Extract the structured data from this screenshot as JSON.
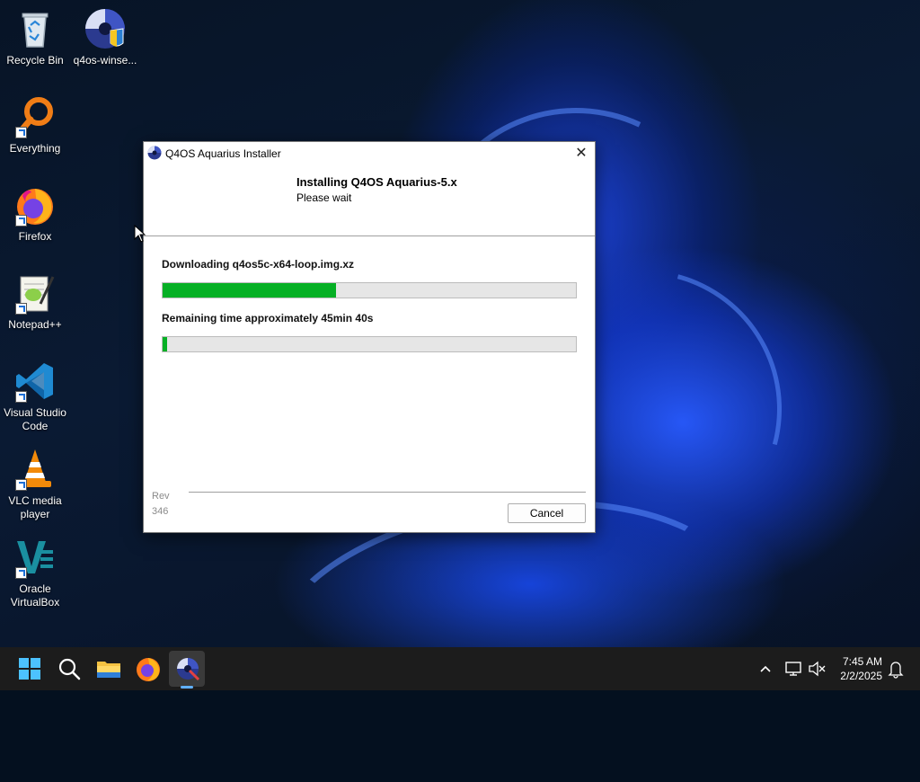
{
  "desktop": {
    "icons": [
      {
        "label": "Recycle Bin"
      },
      {
        "label": "q4os-winse..."
      },
      {
        "label": "Everything"
      },
      {
        "label": "Firefox"
      },
      {
        "label": "Notepad++"
      },
      {
        "label": "Visual Studio Code"
      },
      {
        "label": "VLC media player"
      },
      {
        "label": "Oracle VirtualBox"
      }
    ]
  },
  "dialog": {
    "title": "Q4OS Aquarius Installer",
    "close_label": "✕",
    "heading": "Installing Q4OS Aquarius-5.x",
    "subheading": "Please wait",
    "download_status": "Downloading q4os5c-x64-loop.img.xz",
    "download_progress_percent": 42,
    "remaining_time": "Remaining time approximately 45min 40s",
    "overall_progress_percent": 1,
    "revision": "Rev\n346",
    "cancel_label": "Cancel"
  },
  "taskbar": {
    "items": [
      "start-icon",
      "search-icon",
      "file-explorer-icon",
      "firefox-icon",
      "q4os-installer-icon"
    ],
    "active_item": "q4os-installer-icon",
    "tray_icons": [
      "chevron-up-icon",
      "network-icon",
      "volume-muted-icon",
      "notification-bell-icon"
    ],
    "time": "7:45 AM",
    "date": "2/2/2025"
  },
  "colors": {
    "progress_fill": "#06b025",
    "taskbar_bg": "#1c1c1c",
    "accent": "#60b0ff"
  }
}
